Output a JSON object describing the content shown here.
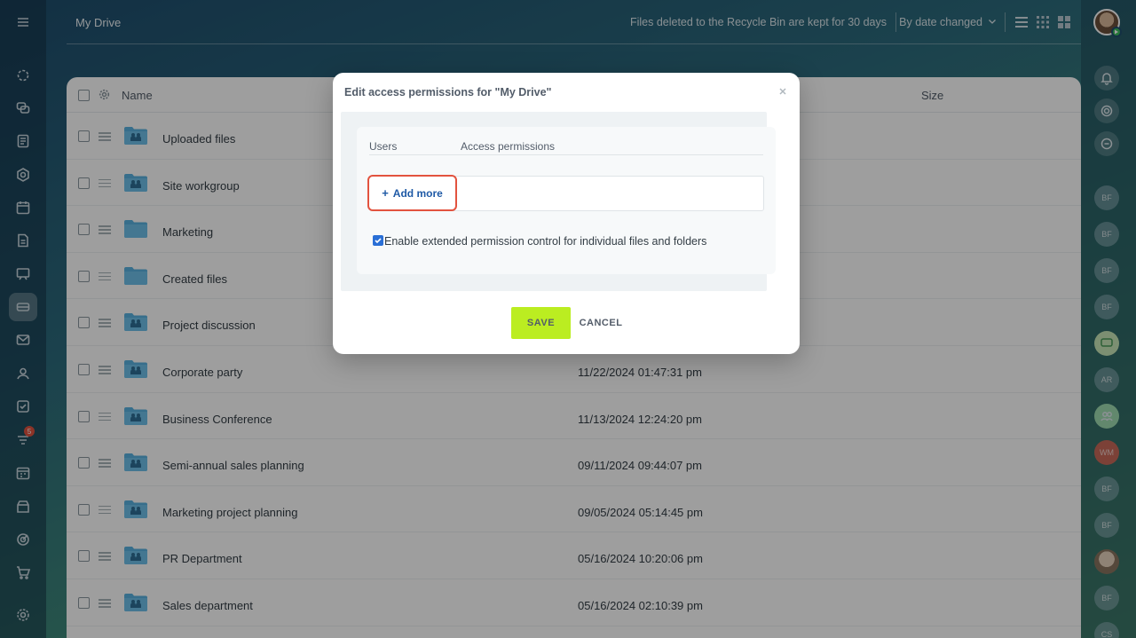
{
  "header": {
    "title": "My Drive",
    "recycle_note": "Files deleted to the Recycle Bin are kept for 30 days",
    "sort_label": "By date changed"
  },
  "table": {
    "col_name": "Name",
    "col_size": "Size",
    "rows": [
      {
        "name": "Uploaded files",
        "date": "",
        "type": "shared"
      },
      {
        "name": "Site workgroup",
        "date": "",
        "type": "shared"
      },
      {
        "name": "Marketing",
        "date": "",
        "type": "plain"
      },
      {
        "name": "Created files",
        "date": "",
        "type": "plain"
      },
      {
        "name": "Project discussion",
        "date": "",
        "type": "shared"
      },
      {
        "name": "Corporate party",
        "date": "11/22/2024 01:47:31 pm",
        "type": "shared"
      },
      {
        "name": "Business Conference",
        "date": "11/13/2024 12:24:20 pm",
        "type": "shared"
      },
      {
        "name": "Semi-annual sales planning",
        "date": "09/11/2024 09:44:07 pm",
        "type": "shared"
      },
      {
        "name": "Marketing project planning",
        "date": "09/05/2024 05:14:45 pm",
        "type": "shared"
      },
      {
        "name": "PR Department",
        "date": "05/16/2024 10:20:06 pm",
        "type": "shared"
      },
      {
        "name": "Sales department",
        "date": "05/16/2024 02:10:39 pm",
        "type": "shared"
      }
    ]
  },
  "dialog": {
    "title": "Edit access permissions for \"My Drive\"",
    "col_users": "Users",
    "col_access": "Access permissions",
    "add_more_label": "Add more",
    "add_more_plus": "+",
    "extended_label": "Enable extended permission control for individual files and folders",
    "extended_checked": true,
    "save_label": "SAVE",
    "cancel_label": "CANCEL"
  },
  "left_sidebar": {
    "badge_count": "5"
  },
  "right_sidebar": {
    "avatars": [
      "BF",
      "BF",
      "BF",
      "BF",
      "AR",
      "WM",
      "BF",
      "BF",
      "BF",
      "CS"
    ]
  },
  "colors": {
    "accent_save": "#bbed21",
    "highlight_red": "#e2533f",
    "link_blue": "#1f5aa6",
    "folder_blue": "#5ab2e0"
  }
}
